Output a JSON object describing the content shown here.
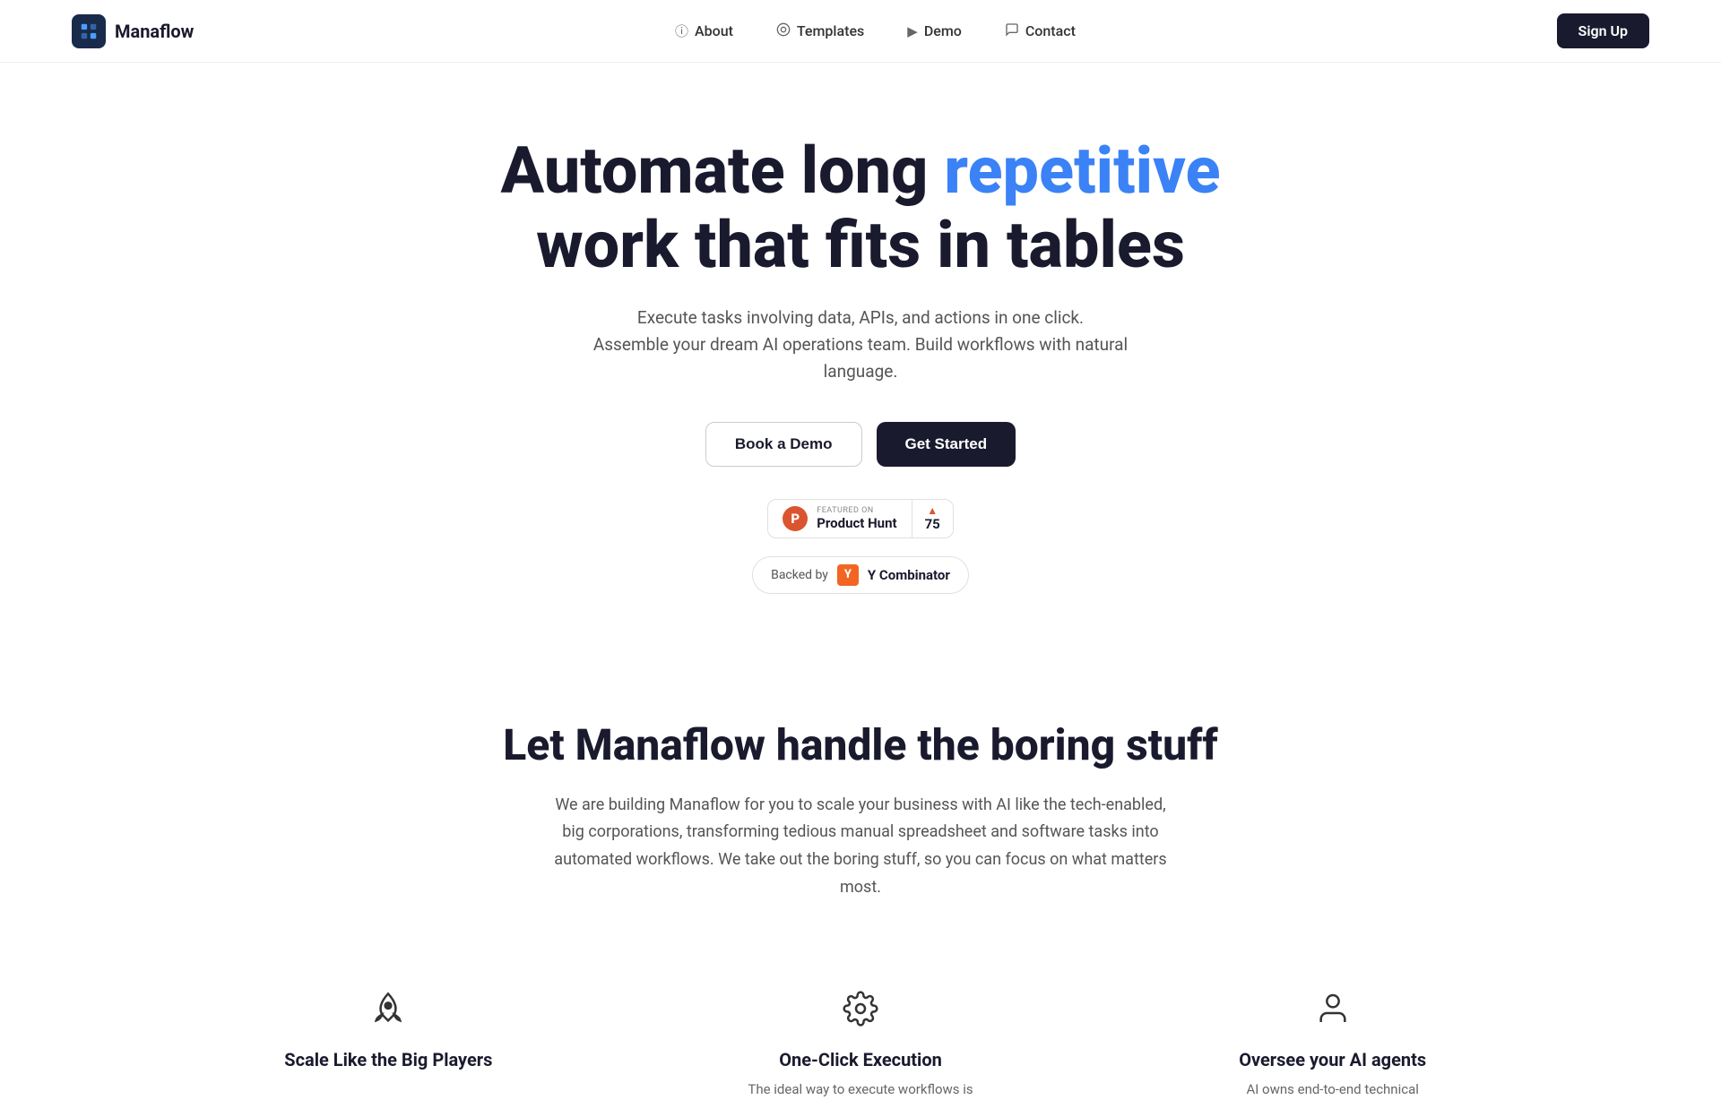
{
  "nav": {
    "logo_text": "Manaflow",
    "links": [
      {
        "id": "about",
        "label": "About",
        "icon": "ℹ"
      },
      {
        "id": "templates",
        "label": "Templates",
        "icon": "◎"
      },
      {
        "id": "demo",
        "label": "Demo",
        "icon": "▶"
      },
      {
        "id": "contact",
        "label": "Contact",
        "icon": "💬"
      }
    ],
    "signup_label": "Sign Up"
  },
  "hero": {
    "title_part1": "Automate long ",
    "title_highlight": "repetitive",
    "title_part2": " work that fits in tables",
    "subtitle_line1": "Execute tasks involving data, APIs, and actions in one click.",
    "subtitle_line2": "Assemble your dream AI operations team. Build workflows with natural language.",
    "btn_demo": "Book a Demo",
    "btn_start": "Get Started",
    "ph_featured_on": "FEATURED ON",
    "ph_product_hunt": "Product Hunt",
    "ph_count": "75",
    "yc_backed_by": "Backed by",
    "yc_logo_letter": "Y",
    "yc_text": "Y Combinator"
  },
  "section2": {
    "title": "Let Manaflow handle the boring stuff",
    "description": "We are building Manaflow for you to scale your business with AI like the tech-enabled, big corporations, transforming tedious manual spreadsheet and software tasks into automated workflows. We take out the boring stuff, so you can focus on what matters most.",
    "features": [
      {
        "icon": "🚀",
        "title": "Scale Like the Big Players",
        "description": ""
      },
      {
        "icon": "⚙",
        "title": "One-Click Execution",
        "description": "The ideal way to execute workflows is"
      },
      {
        "icon": "👤",
        "title": "Oversee your AI agents",
        "description": "AI owns end-to-end technical"
      }
    ]
  }
}
